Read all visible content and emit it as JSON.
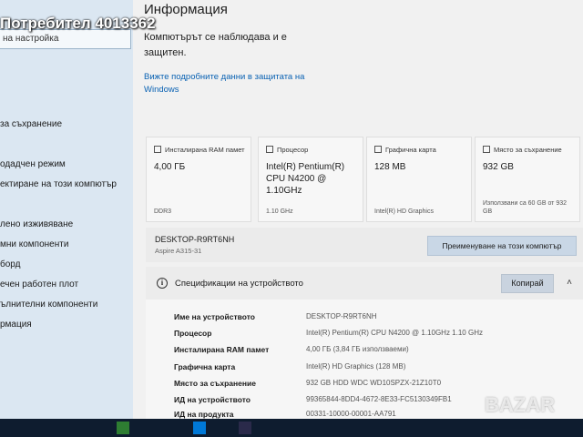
{
  "overlay": {
    "seller": "Потребител 4013362"
  },
  "watermark": "BAZAR",
  "sidebar": {
    "search_value": "на настройка",
    "items": [
      {
        "label": ""
      },
      {
        "label": "за съхранение"
      },
      {
        "label": ""
      },
      {
        "label": "одадчен режим"
      },
      {
        "label": "ектиране на този компютър"
      },
      {
        "label": ""
      },
      {
        "label": "лено изживяване"
      },
      {
        "label": "мни компоненти"
      },
      {
        "label": "борд"
      },
      {
        "label": "ечен работен плот"
      },
      {
        "label": "ълнителни компоненти"
      },
      {
        "label": "рмация"
      }
    ]
  },
  "main": {
    "title": "Информация",
    "monitor_text": "Компютърът се наблюдава и е защитен.",
    "details_link": "Вижте подробните данни в защитата на Windows",
    "cards": [
      {
        "icon": "ram-icon",
        "title": "Инсталирана RAM памет",
        "value": "4,00 ГБ",
        "sub": "DDR3"
      },
      {
        "icon": "cpu-icon",
        "title": "Процесор",
        "value": "Intel(R) Pentium(R) CPU N4200 @ 1.10GHz",
        "sub": "1.10 GHz"
      },
      {
        "icon": "gpu-icon",
        "title": "Графична карта",
        "value": "128 MB",
        "sub": "Intel(R) HD Graphics"
      },
      {
        "icon": "storage-icon",
        "title": "Място за съхранение",
        "value": "932 GB",
        "sub": "Използвани са 60 GB от 932 GB"
      }
    ],
    "device": {
      "name": "DESKTOP-R9RT6NH",
      "model": "Aspire A315-31",
      "rename_label": "Преименуване на този компютър"
    },
    "specs": {
      "title": "Спецификации на устройството",
      "copy_label": "Копирай",
      "rows": [
        {
          "label": "Име на устройството",
          "value": "DESKTOP-R9RT6NH"
        },
        {
          "label": "Процесор",
          "value": "Intel(R) Pentium(R) CPU N4200 @ 1.10GHz   1.10 GHz"
        },
        {
          "label": "Инсталирана RAM памет",
          "value": "4,00 ГБ (3,84 ГБ използваеми)"
        },
        {
          "label": "Графична карта",
          "value": "Intel(R) HD Graphics (128 MB)"
        },
        {
          "label": "Място за съхранение",
          "value": "932 GB HDD WDC WD10SPZX-21Z10T0"
        },
        {
          "label": "ИД на устройството",
          "value": "99365844-8DD4-4672-8E33-FC5130349FB1"
        },
        {
          "label": "ИД на продукта",
          "value": "00331-10000-00001-AA791"
        }
      ]
    }
  },
  "colors": {
    "accent": "#0a62b3",
    "sidebar_bg": "#dbe7f2",
    "panel_bg": "#f1f1f1"
  }
}
